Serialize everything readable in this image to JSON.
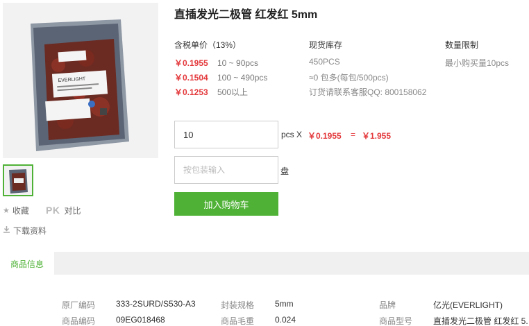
{
  "product": {
    "title": "直插发光二极管 红发红 5mm",
    "image_alt": "EVERLIGHT LED package",
    "brand_on_label": "EVERLIGHT"
  },
  "side": {
    "favorite_label": "收藏",
    "pk_label": "PK",
    "compare_label": "对比",
    "download_label": "下载资料"
  },
  "pricing": {
    "header": "含税单价（13%）",
    "tiers": [
      {
        "price": "￥0.1955",
        "range": "10 ~ 90pcs"
      },
      {
        "price": "￥0.1504",
        "range": "100 ~ 490pcs"
      },
      {
        "price": "￥0.1253",
        "range": "500以上"
      }
    ]
  },
  "stock": {
    "header": "现货库存",
    "quantity": "450PCS",
    "packs": "≈0 包多(每包/500pcs)",
    "contact": "订货请联系客服QQ: 800158062"
  },
  "limit": {
    "header": "数量限制",
    "text": "最小购买量10pcs"
  },
  "order": {
    "qty_value": "10",
    "qty_unit": "pcs X",
    "unit_price": "￥0.1955",
    "equals": "=",
    "total": "￥1.955",
    "pack_placeholder": "按包装输入",
    "pack_unit": "盘",
    "add_to_cart": "加入购物车"
  },
  "tabs": {
    "active": "商品信息"
  },
  "specs": {
    "rows": [
      [
        {
          "label": "原厂编码",
          "value": "333-2SURD/S530-A3"
        },
        {
          "label": "封装规格",
          "value": "5mm"
        },
        {
          "label": "品牌",
          "value": "亿光(EVERLIGHT)"
        }
      ],
      [
        {
          "label": "商品编码",
          "value": "09EG018468"
        },
        {
          "label": "商品毛重",
          "value": "0.024"
        },
        {
          "label": "商品型号",
          "value": "直插发光二极管 红发红 5."
        }
      ]
    ]
  },
  "colors": {
    "accent_green": "#4fb236",
    "price_red": "#e4393c"
  }
}
